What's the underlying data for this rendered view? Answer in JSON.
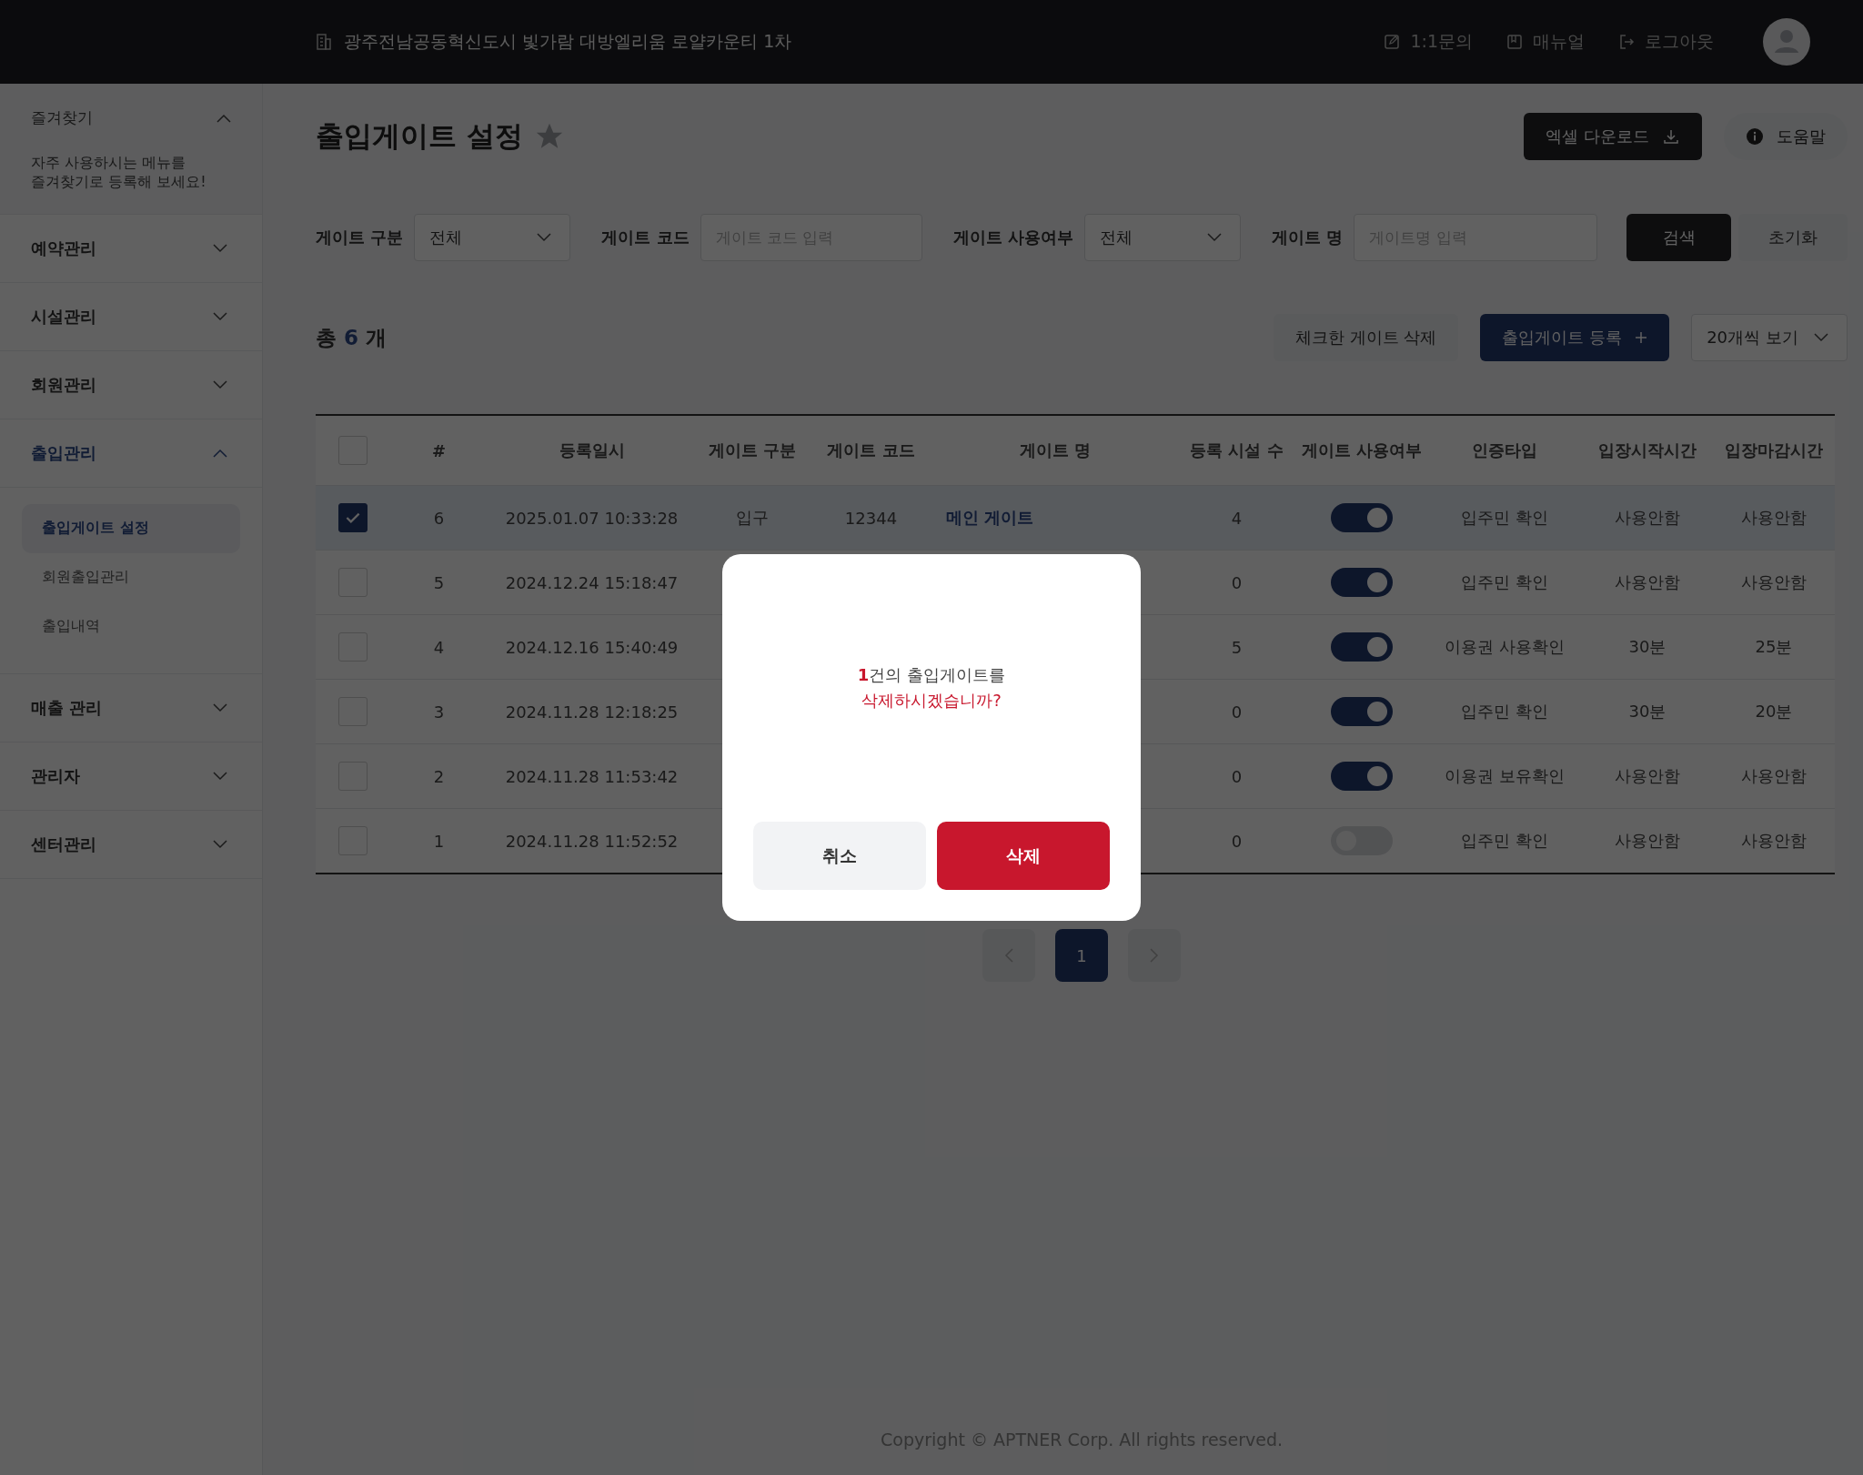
{
  "header": {
    "location": "광주전남공동혁신도시 빛가람 대방엘리움 로얄카운티 1차",
    "links": [
      {
        "kind": "inquiry",
        "label": "1:1문의"
      },
      {
        "kind": "manual",
        "label": "매뉴얼"
      },
      {
        "kind": "logout",
        "label": "로그아웃"
      }
    ]
  },
  "sidebar": {
    "favorites": {
      "title": "즐겨찾기",
      "expanded": true,
      "hint": "자주 사용하시는 메뉴를\n즐겨찾기로 등록해 보세요!"
    },
    "menus": [
      {
        "label": "예약관리",
        "expanded": false,
        "selected": false
      },
      {
        "label": "시설관리",
        "expanded": false,
        "selected": false
      },
      {
        "label": "회원관리",
        "expanded": false,
        "selected": false
      },
      {
        "label": "출입관리",
        "expanded": true,
        "selected": true,
        "children": [
          {
            "label": "출입게이트 설정",
            "selected": true
          },
          {
            "label": "회원출입관리",
            "selected": false
          },
          {
            "label": "출입내역",
            "selected": false
          }
        ]
      },
      {
        "label": "매출 관리",
        "expanded": false,
        "selected": false
      },
      {
        "label": "관리자",
        "expanded": false,
        "selected": false
      },
      {
        "label": "센터관리",
        "expanded": false,
        "selected": false
      }
    ]
  },
  "page": {
    "title": "출입게이트 설정",
    "excel_button": "엑셀 다운로드",
    "help_button": "도움말"
  },
  "filters": [
    {
      "kind": "select",
      "label": "게이트 구분",
      "value": "전체"
    },
    {
      "kind": "input",
      "label": "게이트 코드",
      "placeholder": "게이트 코드 입력"
    },
    {
      "kind": "select",
      "label": "게이트 사용여부",
      "value": "전체"
    },
    {
      "kind": "input",
      "label": "게이트 명",
      "placeholder": "게이트명 입력"
    }
  ],
  "search_button": "검색",
  "reset_button": "초기화",
  "count": {
    "prefix": "총",
    "number": "6",
    "suffix": "개"
  },
  "actions": {
    "delete_checked": "체크한 게이트 삭제",
    "register": "출입게이트 등록",
    "page_size": "20개씩 보기"
  },
  "table": {
    "columns": [
      "#",
      "등록일시",
      "게이트 구분",
      "게이트 코드",
      "게이트 명",
      "등록 시설 수",
      "게이트 사용여부",
      "인증타입",
      "입장시작시간",
      "입장마감시간"
    ],
    "all_checked": false,
    "rows": [
      {
        "checked": true,
        "no": "6",
        "date": "2025.01.07 10:33:28",
        "type": "입구",
        "code": "12344",
        "name": "메인 게이트",
        "facilities": "4",
        "on": true,
        "auth": "입주민 확인",
        "start": "사용안함",
        "end": "사용안함"
      },
      {
        "checked": false,
        "no": "5",
        "date": "2024.12.24 15:18:47",
        "facilities": "0",
        "on": true,
        "auth": "입주민 확인",
        "start": "사용안함",
        "end": "사용안함"
      },
      {
        "checked": false,
        "no": "4",
        "date": "2024.12.16 15:40:49",
        "facilities": "5",
        "on": true,
        "auth": "이용권 사용확인",
        "start": "30분",
        "end": "25분"
      },
      {
        "checked": false,
        "no": "3",
        "date": "2024.11.28 12:18:25",
        "facilities": "0",
        "on": true,
        "auth": "입주민 확인",
        "start": "30분",
        "end": "20분"
      },
      {
        "checked": false,
        "no": "2",
        "date": "2024.11.28 11:53:42",
        "facilities": "0",
        "on": true,
        "auth": "이용권 보유확인",
        "start": "사용안함",
        "end": "사용안함"
      },
      {
        "checked": false,
        "no": "1",
        "date": "2024.11.28 11:52:52",
        "facilities": "0",
        "on": false,
        "auth": "입주민 확인",
        "start": "사용안함",
        "end": "사용안함"
      }
    ]
  },
  "pagination": {
    "pages": [
      {
        "label": "1",
        "selected": true
      }
    ]
  },
  "modal": {
    "line1": "**1**건의 출입게이트를",
    "line2": "삭제하시겠습니까?",
    "cancel": "취소",
    "confirm": "삭제"
  },
  "footer": "Copyright © APTNER Corp. All rights reserved."
}
